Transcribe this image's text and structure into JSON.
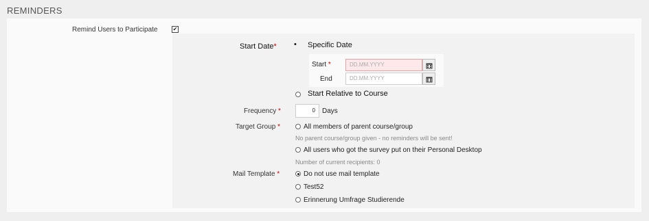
{
  "section": {
    "title": "REMINDERS"
  },
  "remind": {
    "label": "Remind Users to Participate",
    "checked": true,
    "check_glyph": "✔"
  },
  "start_date": {
    "label": "Start Date",
    "required_marker": "*",
    "specific_label": "Specific Date",
    "start_label": "Start",
    "end_label": "End",
    "start_placeholder": "DD.MM.YYYY",
    "end_placeholder": "DD.MM.YYYY",
    "relative_label": "Start Relative to Course",
    "bullet": "•"
  },
  "frequency": {
    "label": "Frequency",
    "value": "0",
    "unit": "Days"
  },
  "target_group": {
    "label": "Target Group",
    "options": [
      {
        "label": "All members of parent course/group",
        "hint": "No parent course/group given - no reminders will be sent!"
      },
      {
        "label": "All users who got the survey put on their Personal Desktop",
        "hint": "Number of current recipients: 0"
      }
    ]
  },
  "mail_template": {
    "label": "Mail Template",
    "options": [
      {
        "label": "Do not use mail template",
        "selected": true
      },
      {
        "label": "Test52",
        "selected": false
      },
      {
        "label": "Erinnerung Umfrage Studierende",
        "selected": false
      }
    ]
  },
  "icons": {
    "calendar": "calendar-icon"
  }
}
